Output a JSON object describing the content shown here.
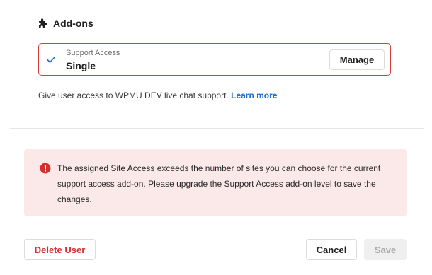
{
  "addons": {
    "title": "Add-ons",
    "icon": "puzzle-piece-icon",
    "card": {
      "label": "Support Access",
      "value": "Single",
      "manage_label": "Manage",
      "check_icon": "check-icon",
      "border_color": "#d93a3a"
    },
    "helper_text": "Give user access to WPMU DEV live chat support.",
    "learn_more_label": "Learn more"
  },
  "alert": {
    "icon": "error-circle-icon",
    "message": "The assigned Site Access exceeds the number of sites you can choose for the current support access add-on. Please upgrade the Support Access add-on level to save the changes.",
    "background": "#fbe9e9",
    "icon_color": "#d32f2f"
  },
  "footer": {
    "delete_label": "Delete User",
    "cancel_label": "Cancel",
    "save_label": "Save"
  },
  "colors": {
    "link": "#1a6fd1",
    "danger": "#d32f2f",
    "check": "#1a6fd1"
  }
}
